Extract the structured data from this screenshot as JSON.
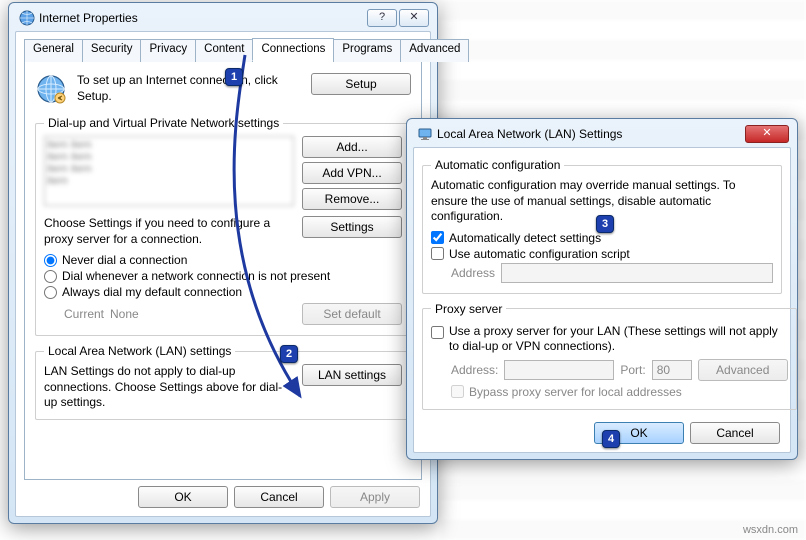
{
  "ip": {
    "title": "Internet Properties",
    "tabs": {
      "general": "General",
      "security": "Security",
      "privacy": "Privacy",
      "content": "Content",
      "connections": "Connections",
      "programs": "Programs",
      "advanced": "Advanced"
    },
    "setup_text": "To set up an Internet connection, click Setup.",
    "btn": {
      "setup": "Setup",
      "add": "Add...",
      "addvpn": "Add VPN...",
      "remove": "Remove...",
      "settings": "Settings",
      "setdefault": "Set default",
      "lansettings": "LAN settings",
      "ok": "OK",
      "cancel": "Cancel",
      "apply": "Apply"
    },
    "group": {
      "dialup": "Dial-up and Virtual Private Network settings",
      "lan": "Local Area Network (LAN) settings"
    },
    "help": {
      "settings": "Choose Settings if you need to configure a proxy server for a connection.",
      "lan": "LAN Settings do not apply to dial-up connections. Choose Settings above for dial-up settings."
    },
    "radio": {
      "never": "Never dial a connection",
      "when": "Dial whenever a network connection is not present",
      "always": "Always dial my default connection"
    },
    "currentlbl": "Current",
    "currentval": "None"
  },
  "lan": {
    "title": "Local Area Network (LAN) Settings",
    "group": {
      "auto": "Automatic configuration",
      "proxy": "Proxy server"
    },
    "autotext": "Automatic configuration may override manual settings.  To ensure the use of manual settings, disable automatic configuration.",
    "chk": {
      "autodetect": "Automatically detect settings",
      "usescript": "Use automatic configuration script",
      "useproxy": "Use a proxy server for your LAN (These settings will not apply to dial-up or VPN connections).",
      "bypass": "Bypass proxy server for local addresses"
    },
    "lbl": {
      "address": "Address",
      "address2": "Address:",
      "port": "Port:"
    },
    "val": {
      "port": "80"
    },
    "btn": {
      "advanced": "Advanced",
      "ok": "OK",
      "cancel": "Cancel"
    }
  },
  "badges": {
    "1": "1",
    "2": "2",
    "3": "3",
    "4": "4"
  },
  "watermark": "wsxdn.com"
}
